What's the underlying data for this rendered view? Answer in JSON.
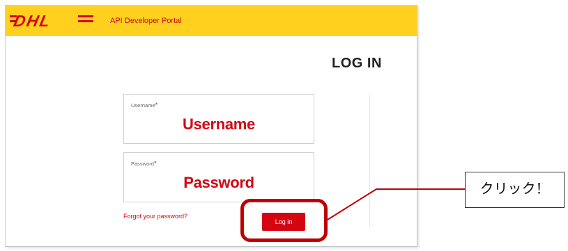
{
  "header": {
    "logo_text": "DHL",
    "portal_title": "API Developer Portal"
  },
  "page": {
    "heading": "LOG IN"
  },
  "form": {
    "username": {
      "label": "Username",
      "required_mark": "*",
      "value": "Username"
    },
    "password": {
      "label": "Password",
      "required_mark": "*",
      "value": "Password"
    },
    "forgot_link": "Forgot your password?",
    "login_button": "Log in"
  },
  "annotation": {
    "callout_text": "クリック！"
  },
  "colors": {
    "brand_yellow": "#ffd11e",
    "brand_red": "#d40511",
    "highlight_red": "#c00000"
  }
}
